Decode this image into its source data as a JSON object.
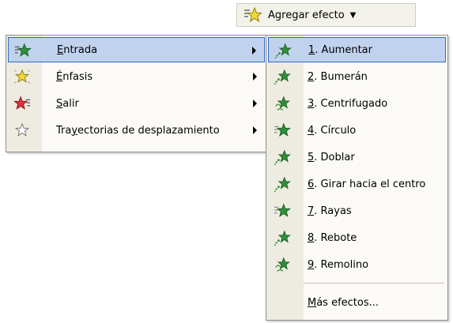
{
  "button": {
    "label": "Agregar efecto",
    "icon": "star-effect-icon"
  },
  "menu1": {
    "items": [
      {
        "hot": "E",
        "rest": "ntrada",
        "icon": "entrance-star-icon",
        "highlight": true
      },
      {
        "hot": "É",
        "rest": "nfasis",
        "icon": "emphasis-star-icon"
      },
      {
        "hot": "S",
        "rest": "alir",
        "icon": "exit-star-icon"
      },
      {
        "pre": "Tra",
        "hot": "y",
        "rest": "ectorias de desplazamiento",
        "icon": "motion-path-star-icon"
      }
    ]
  },
  "menu2": {
    "items": [
      {
        "hot": "1",
        "rest": ". Aumentar",
        "icon": "effect-icon"
      },
      {
        "hot": "2",
        "rest": ". Bumerán",
        "icon": "effect-icon"
      },
      {
        "hot": "3",
        "rest": ". Centrifugado",
        "icon": "effect-icon"
      },
      {
        "hot": "4",
        "rest": ". Círculo",
        "icon": "effect-icon"
      },
      {
        "hot": "5",
        "rest": ". Doblar",
        "icon": "effect-icon"
      },
      {
        "hot": "6",
        "rest": ". Girar hacia el centro",
        "icon": "effect-icon"
      },
      {
        "hot": "7",
        "rest": ". Rayas",
        "icon": "effect-icon"
      },
      {
        "hot": "8",
        "rest": ". Rebote",
        "icon": "effect-icon"
      },
      {
        "hot": "9",
        "rest": ". Remolino",
        "icon": "effect-icon"
      }
    ],
    "more": {
      "hot": "M",
      "rest": "ás efectos..."
    }
  },
  "colors": {
    "highlight_bg": "#c1d2ee",
    "highlight_border": "#316ac5",
    "star_green": "#2f8f3a",
    "star_yellow": "#f1d93a",
    "star_red": "#e0303c"
  }
}
